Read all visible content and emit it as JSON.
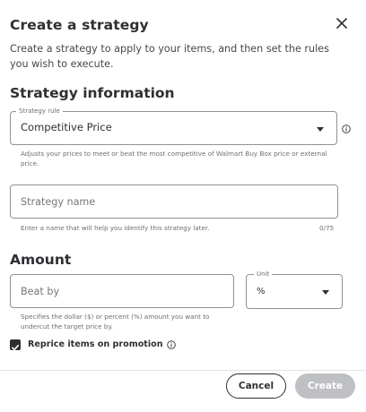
{
  "modal": {
    "title": "Create a strategy",
    "intro": "Create a strategy to apply to your items, and then set the rules you wish to execute."
  },
  "strategy_info": {
    "heading": "Strategy information",
    "rule_legend": "Strategy rule",
    "rule_value": "Competitive Price",
    "rule_helper": "Adjusts your prices to meet or beat the most competitive of Walmart Buy Box price or external price.",
    "name_placeholder": "Strategy name",
    "name_value": "",
    "name_helper": "Enter a name that will help you identify this strategy later.",
    "name_counter": "0/75"
  },
  "amount": {
    "heading": "Amount",
    "beat_placeholder": "Beat by",
    "beat_value": "",
    "beat_helper": "Specifies the dollar ($) or percent (%) amount you want to undercut the target price by.",
    "unit_legend": "Unit",
    "unit_value": "%"
  },
  "promotion": {
    "checked": true,
    "label": "Reprice items on promotion"
  },
  "footer": {
    "cancel_label": "Cancel",
    "create_label": "Create"
  },
  "colors": {
    "text": "#2e2f32",
    "border": "#909196",
    "disabled": "#bfc0c3"
  },
  "icons": {
    "close": "close-icon",
    "info": "info-icon",
    "dropdown": "chevron-down-icon",
    "check": "check-icon"
  }
}
